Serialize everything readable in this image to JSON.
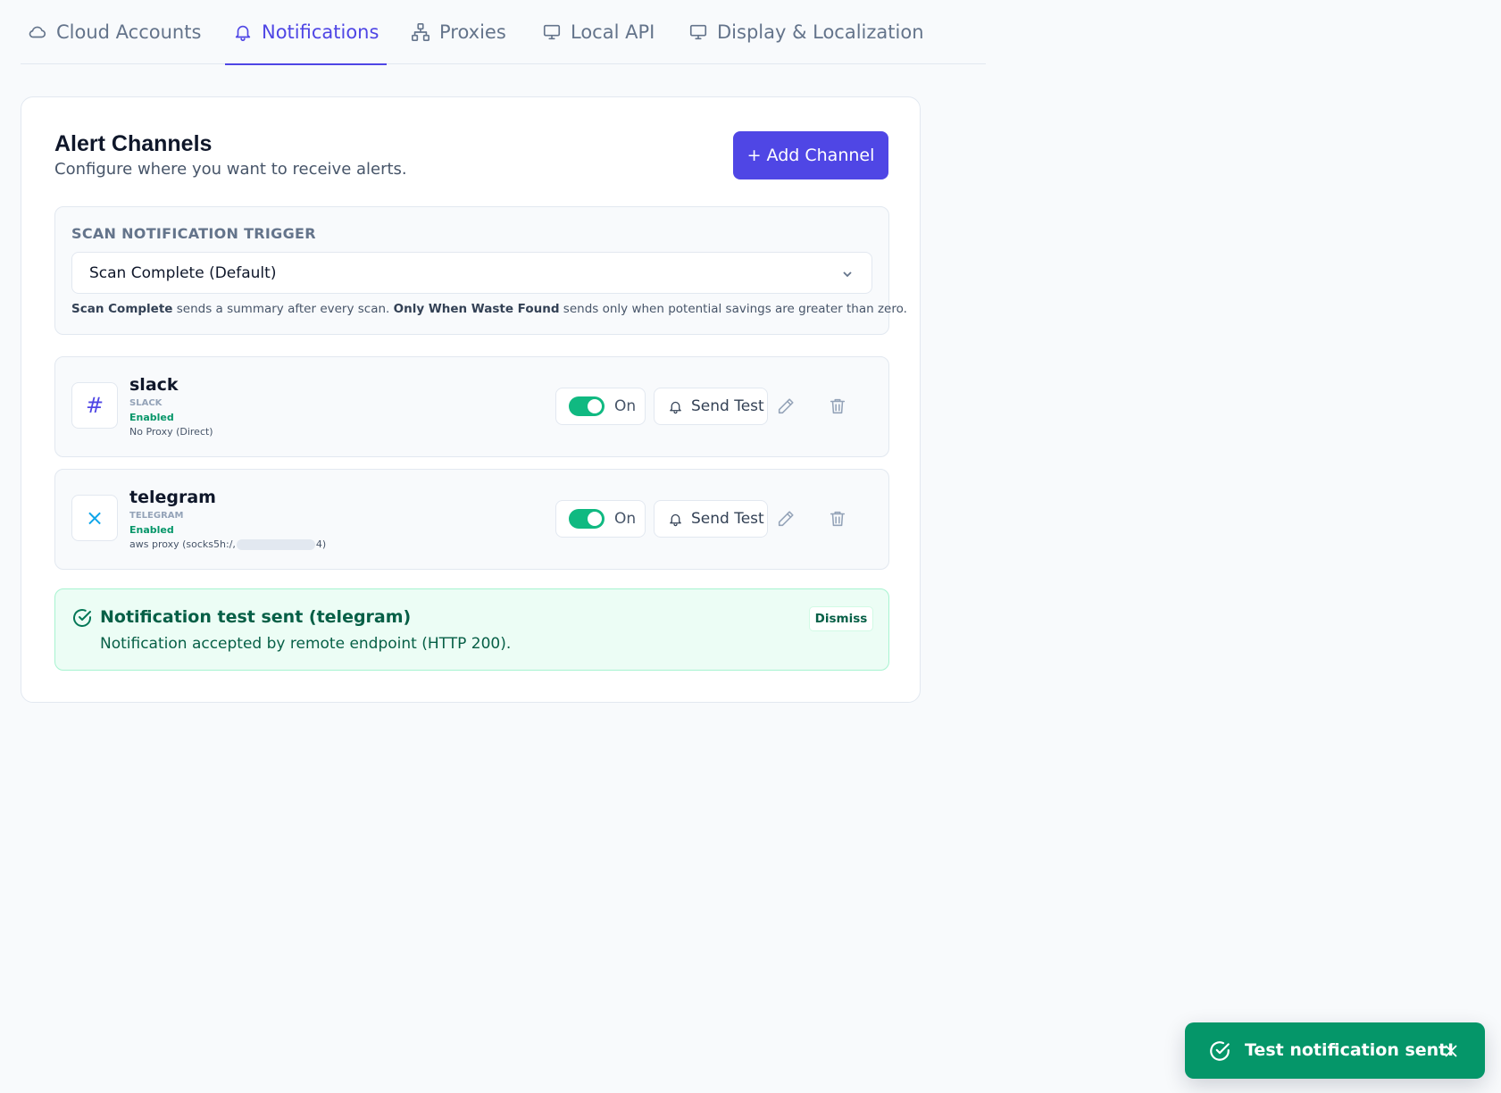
{
  "tabs": [
    {
      "label": "Cloud Accounts",
      "icon": "cloud-icon",
      "active": false
    },
    {
      "label": "Notifications",
      "icon": "bell-icon",
      "active": true
    },
    {
      "label": "Proxies",
      "icon": "network-icon",
      "active": false
    },
    {
      "label": "Local API",
      "icon": "monitor-icon",
      "active": false
    },
    {
      "label": "Display & Localization",
      "icon": "monitor-icon",
      "active": false
    }
  ],
  "card": {
    "title": "Alert Channels",
    "subtitle": "Configure where you want to receive alerts.",
    "add_button": "+ Add Channel"
  },
  "trigger": {
    "label": "SCAN NOTIFICATION TRIGGER",
    "selected": "Scan Complete (Default)",
    "help": {
      "opt1": "Scan Complete",
      "text1": " sends a summary after every scan. ",
      "opt2": "Only When Waste Found",
      "text2": " sends only when potential savings are greater than zero."
    }
  },
  "channels": [
    {
      "name": "slack",
      "type": "SLACK",
      "status": "Enabled",
      "proxy": "No Proxy (Direct)",
      "icon_glyph": "#",
      "icon_color": "#4f46e5",
      "toggle_label": "On",
      "send_test": "Send Test"
    },
    {
      "name": "telegram",
      "type": "TELEGRAM",
      "status": "Enabled",
      "proxy_prefix": "aws proxy (socks5h:/,",
      "proxy_suffix": "4)",
      "icon_glyph": "×",
      "icon_color": "#0ea5e9",
      "toggle_label": "On",
      "send_test": "Send Test"
    }
  ],
  "banner": {
    "title": "Notification test sent (telegram)",
    "message": "Notification accepted by remote endpoint (HTTP 200).",
    "dismiss": "Dismiss"
  },
  "toast": {
    "text": "Test notification sent!"
  },
  "colors": {
    "accent": "#4f46e5",
    "success": "#059669",
    "toggle_on": "#10b981"
  }
}
